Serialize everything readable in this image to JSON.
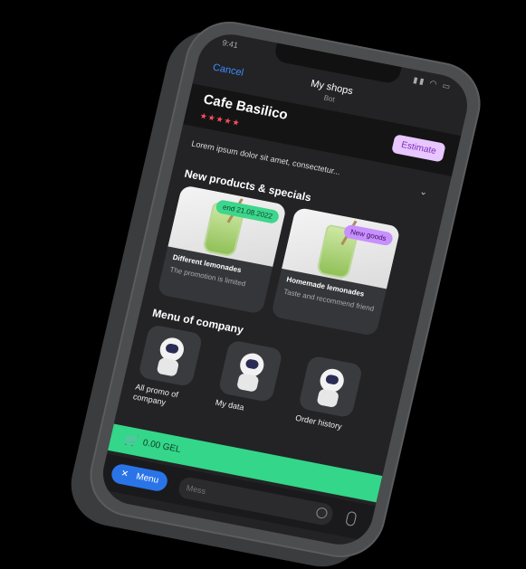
{
  "status": {
    "time": "9:41",
    "icons": "▮▮ ◠ ▭"
  },
  "navbar": {
    "cancel": "Cancel",
    "title": "My shops",
    "subtitle": "Bot"
  },
  "shop": {
    "name": "Cafe Basilico",
    "stars": "★★★★★",
    "estimate_label": "Estimate"
  },
  "description": {
    "text": "Lorem ipsum dolor sit amet, consectetur...",
    "chevron": "⌄"
  },
  "sections": {
    "products": "New products & specials",
    "menu": "Menu of company"
  },
  "promos": [
    {
      "tag": "end 21.08.2022",
      "title": "Different lemonades",
      "text": "The promotion is limited"
    },
    {
      "tag": "New goods",
      "title": "Homemade lemonades",
      "text": "Taste and recommend friend"
    }
  ],
  "menu_items": [
    {
      "label": "All promo of company"
    },
    {
      "label": "My data"
    },
    {
      "label": "Order history"
    }
  ],
  "cart": {
    "icon": "🛒",
    "total": "0.00 GEL"
  },
  "bottom": {
    "menu_label": "Menu",
    "menu_icon": "✕",
    "message_placeholder": "Mess"
  },
  "colors": {
    "accent_green": "#34d68a",
    "accent_blue": "#2a74e8",
    "estimate_bg": "#e8c6ff",
    "star": "#ff4f5e"
  }
}
